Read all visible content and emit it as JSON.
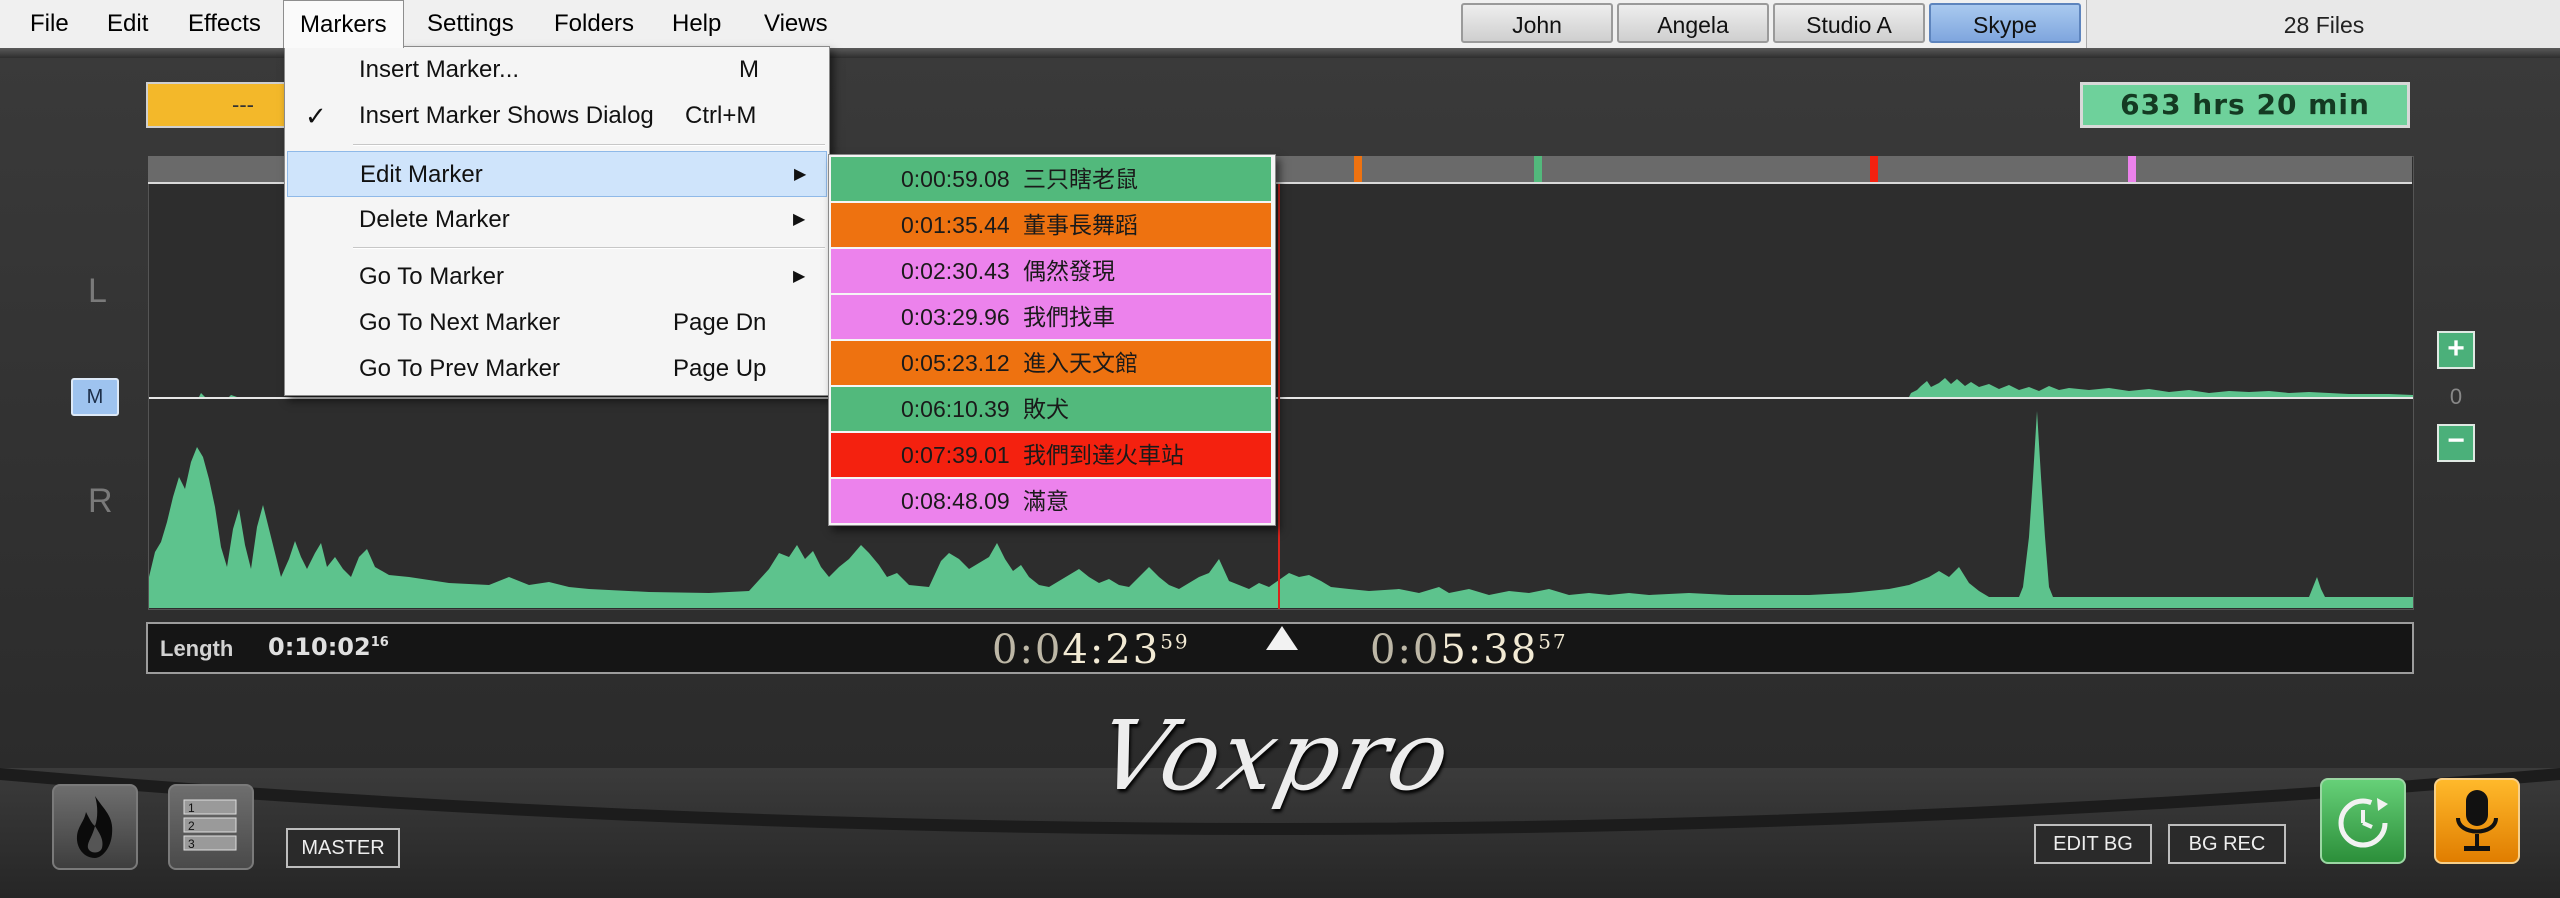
{
  "menu_bar": {
    "items": [
      "File",
      "Edit",
      "Effects",
      "Markers",
      "Settings",
      "Folders",
      "Help",
      "Views"
    ],
    "active": "Markers"
  },
  "users": {
    "buttons": [
      "John",
      "Angela",
      "Studio A",
      "Skype"
    ],
    "selected": "Skype"
  },
  "file_count": "28 Files",
  "yellow_field": "---",
  "time_remaining": "633 hrs  20 min",
  "channels": {
    "left": "L",
    "right": "R",
    "mute": "M"
  },
  "zoom": {
    "plus": "+",
    "minus": "−",
    "level": "0"
  },
  "markers_menu": {
    "items": [
      {
        "label": "Insert Marker...",
        "shortcut": "M",
        "checked": false,
        "submenu": false
      },
      {
        "label": "Insert Marker Shows Dialog",
        "shortcut": "Ctrl+M",
        "checked": true,
        "submenu": false
      },
      {
        "label": "Edit Marker",
        "shortcut": "",
        "checked": false,
        "submenu": true,
        "highlighted": true
      },
      {
        "label": "Delete Marker",
        "shortcut": "",
        "checked": false,
        "submenu": true
      },
      {
        "label": "Go To Marker",
        "shortcut": "",
        "checked": false,
        "submenu": true
      },
      {
        "label": "Go To Next Marker",
        "shortcut": "Page Dn",
        "checked": false,
        "submenu": false
      },
      {
        "label": "Go To Prev Marker",
        "shortcut": "Page Up",
        "checked": false,
        "submenu": false
      }
    ]
  },
  "edit_marker_submenu": [
    {
      "time": "0:00:59.08",
      "name": "三只瞎老鼠",
      "color": "#52b97c"
    },
    {
      "time": "0:01:35.44",
      "name": "董事長舞蹈",
      "color": "#ee7210"
    },
    {
      "time": "0:02:30.43",
      "name": "偶然發現",
      "color": "#ec82ec"
    },
    {
      "time": "0:03:29.96",
      "name": "我們找車",
      "color": "#ec82ec"
    },
    {
      "time": "0:05:23.12",
      "name": "進入天文館",
      "color": "#ee7210"
    },
    {
      "time": "0:06:10.39",
      "name": "敗犬",
      "color": "#52b97c"
    },
    {
      "time": "0:07:39.01",
      "name": "我們到達火車站",
      "color": "#f4210f"
    },
    {
      "time": "0:08:48.09",
      "name": "滿意",
      "color": "#ec82ec"
    }
  ],
  "timeline_marker_colors": [
    "#ee7210",
    "#52b97c",
    "#f4210f",
    "#ec82ec"
  ],
  "length": {
    "label": "Length",
    "main": "0:10:02",
    "frac": "16"
  },
  "position_time": {
    "prefix": "0:0",
    "main": "4:23",
    "frac": "59"
  },
  "remaining_time": {
    "prefix": "0:0",
    "main": "5:38",
    "frac": "57"
  },
  "logo": "Voxpro",
  "buttons": {
    "master": "MASTER",
    "edit_bg": "EDIT BG",
    "bg_rec": "BG REC",
    "list_numbers": [
      "1",
      "2",
      "3"
    ]
  },
  "icons": [
    "fire-icon",
    "numbered-list-icon",
    "recycle-timer-icon",
    "microphone-icon"
  ]
}
